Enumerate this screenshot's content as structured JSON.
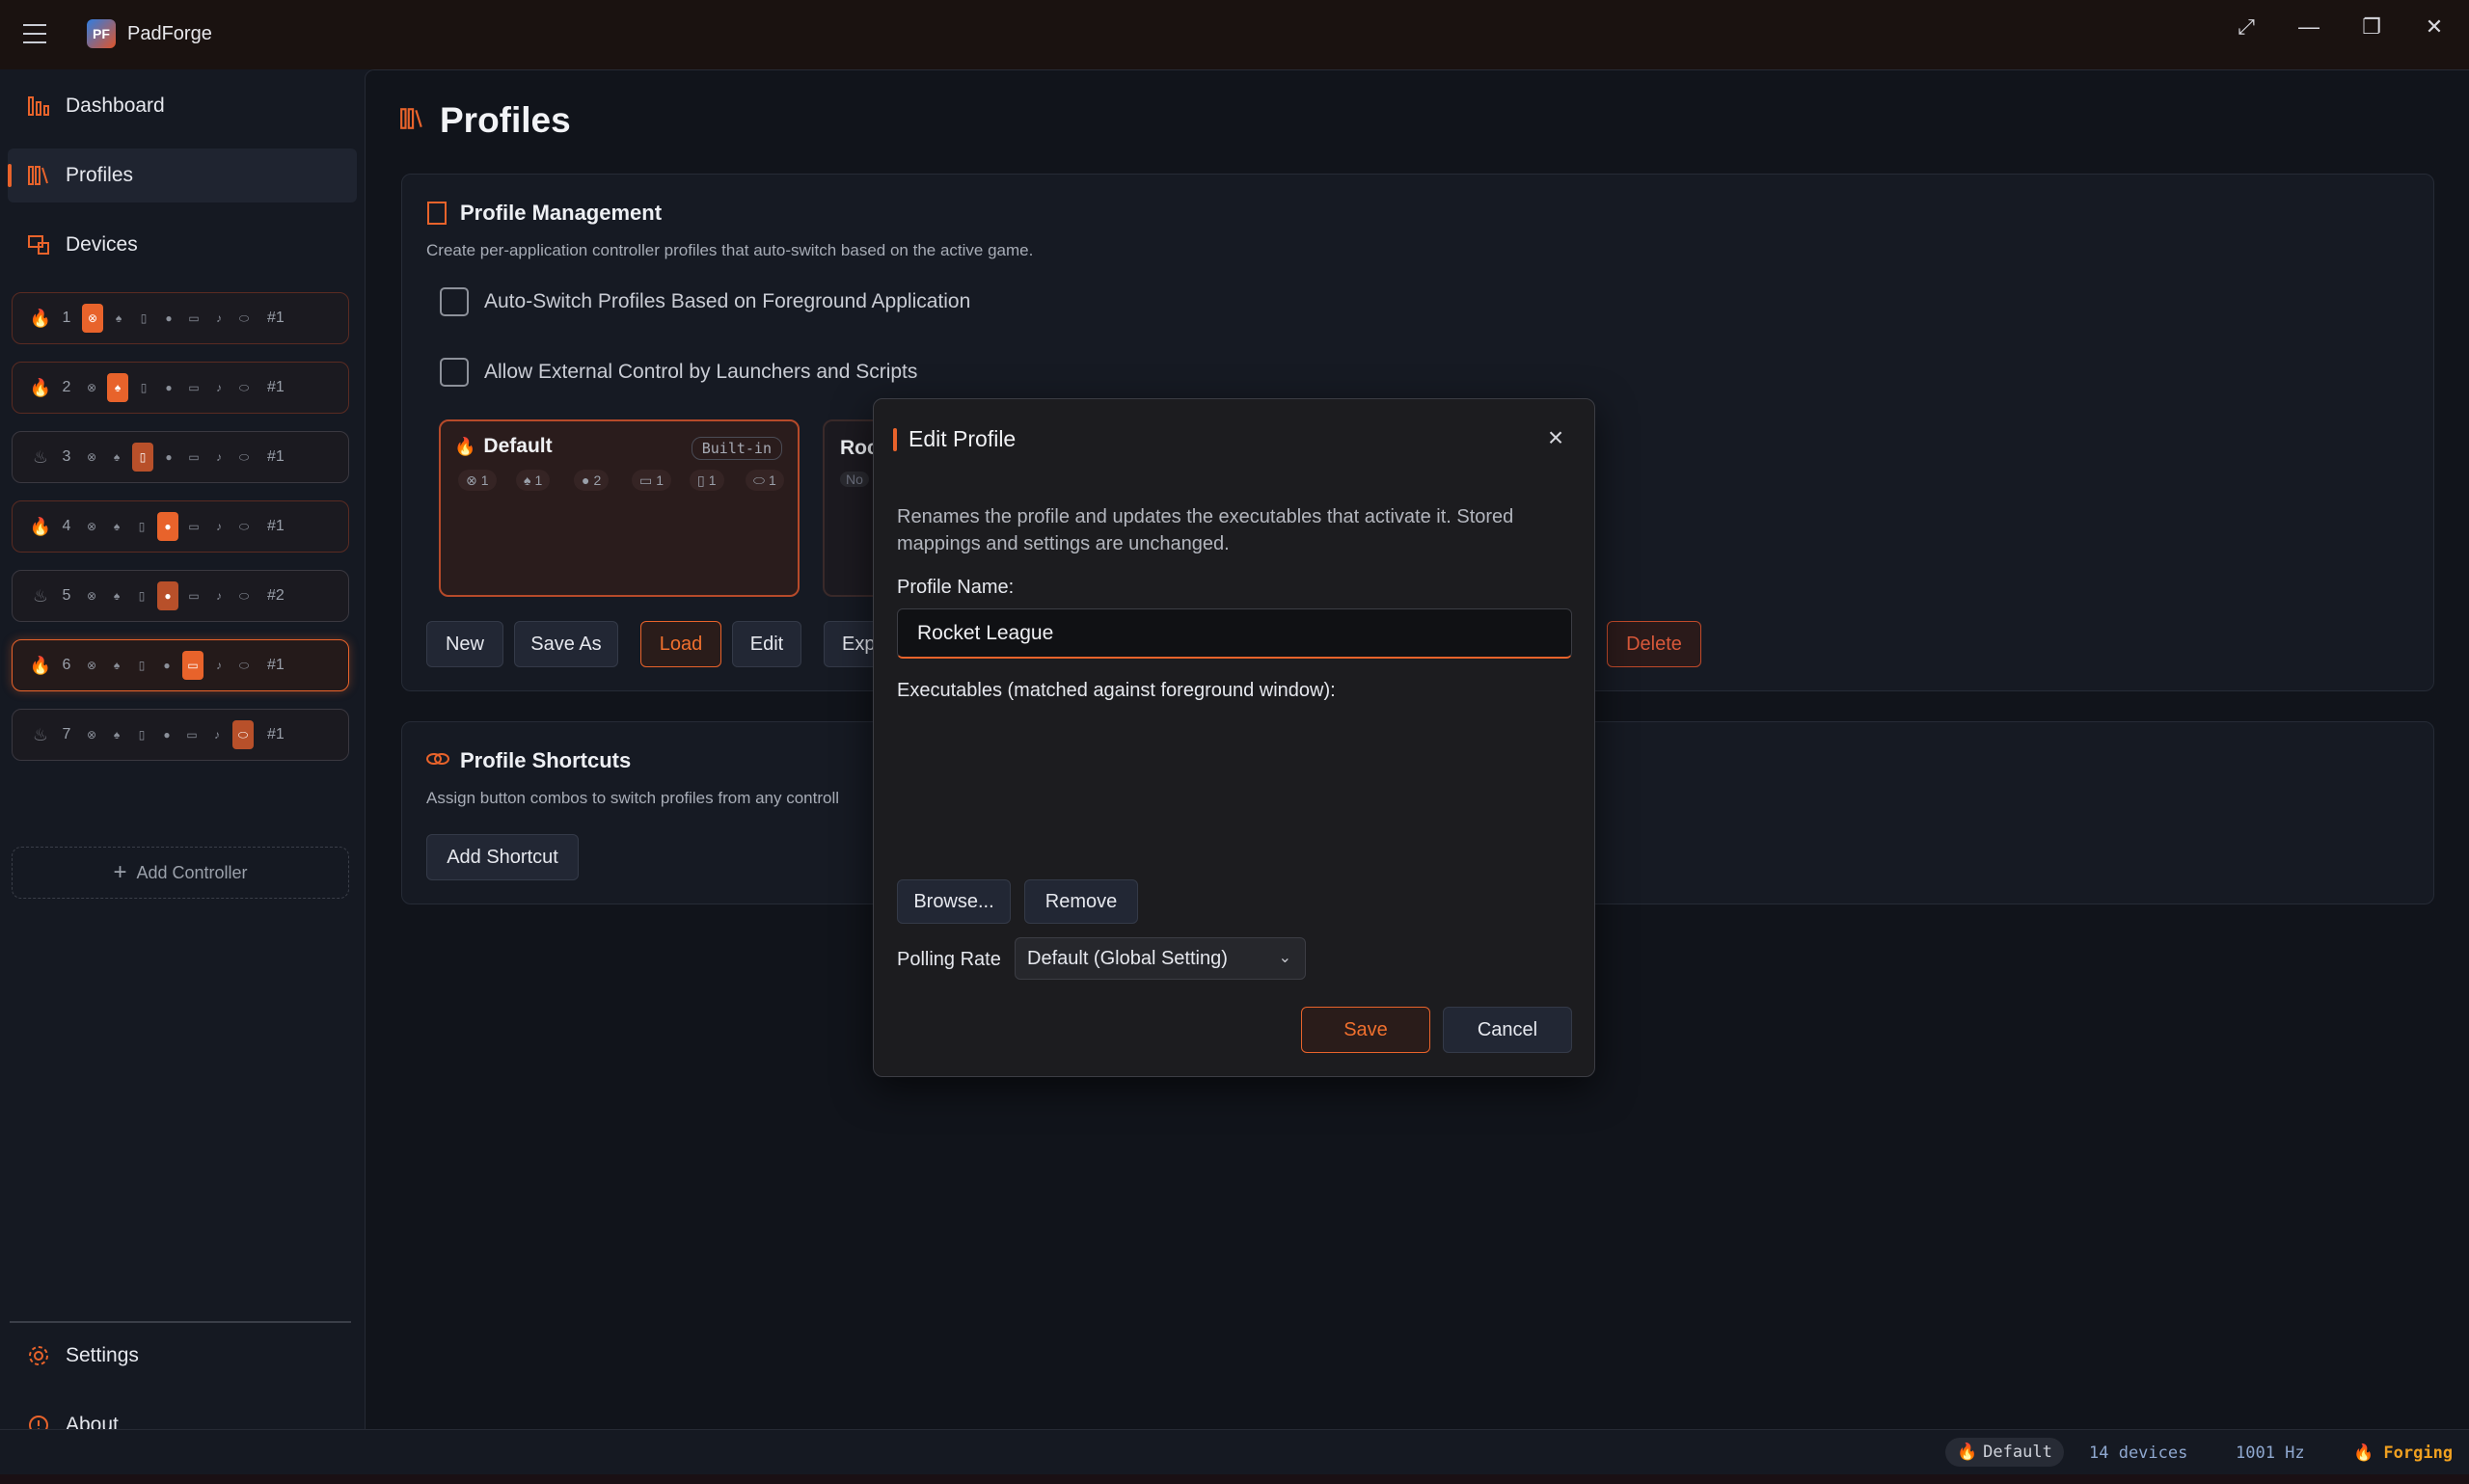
{
  "app": {
    "title": "PadForge",
    "logo_text": "PF"
  },
  "sidebar": {
    "nav": [
      {
        "label": "Dashboard"
      },
      {
        "label": "Profiles"
      },
      {
        "label": "Devices"
      }
    ],
    "controllers": [
      {
        "slot": "1",
        "tag": "#1",
        "active_type": 0
      },
      {
        "slot": "2",
        "tag": "#1",
        "active_type": 1
      },
      {
        "slot": "3",
        "tag": "#1",
        "active_type": 2
      },
      {
        "slot": "4",
        "tag": "#1",
        "active_type": 3
      },
      {
        "slot": "5",
        "tag": "#2",
        "active_type": 3
      },
      {
        "slot": "6",
        "tag": "#1",
        "active_type": 4
      },
      {
        "slot": "7",
        "tag": "#1",
        "active_type": 6
      }
    ],
    "add_controller": "Add Controller",
    "bottom_nav": [
      {
        "label": "Settings"
      },
      {
        "label": "About"
      }
    ]
  },
  "page": {
    "title": "Profiles"
  },
  "profile_management": {
    "title": "Profile Management",
    "description": "Create per-application controller profiles that auto-switch based on the active game.",
    "auto_switch_label": "Auto-Switch Profiles Based on Foreground Application",
    "external_control_label": "Allow External Control by Launchers and Scripts",
    "default_profile": {
      "name": "Default",
      "badge": "Built-in",
      "counts": [
        "1",
        "1",
        "2",
        "1",
        "1",
        "1"
      ]
    },
    "second_profile": {
      "name_fragment": "Roc",
      "subtext_fragment": "No"
    },
    "buttons": {
      "new": "New",
      "save_as": "Save As",
      "load": "Load",
      "edit": "Edit",
      "export": "Exp",
      "delete": "Delete"
    }
  },
  "profile_shortcuts": {
    "title": "Profile Shortcuts",
    "description": "Assign button combos to switch profiles from any controll",
    "add_button": "Add Shortcut"
  },
  "modal": {
    "title": "Edit Profile",
    "description": "Renames the profile and updates the executables that activate it. Stored mappings and settings are unchanged.",
    "name_label": "Profile Name:",
    "name_value": "Rocket League",
    "executables_label": "Executables (matched against foreground window):",
    "browse": "Browse...",
    "remove": "Remove",
    "polling_label": "Polling Rate",
    "polling_value": "Default (Global Setting)",
    "save": "Save",
    "cancel": "Cancel"
  },
  "statusbar": {
    "profile": "Default",
    "devices": "14 devices",
    "rate": "1001 Hz",
    "state": "Forging"
  },
  "colors": {
    "accent": "#e8632b",
    "background": "#11141b"
  }
}
